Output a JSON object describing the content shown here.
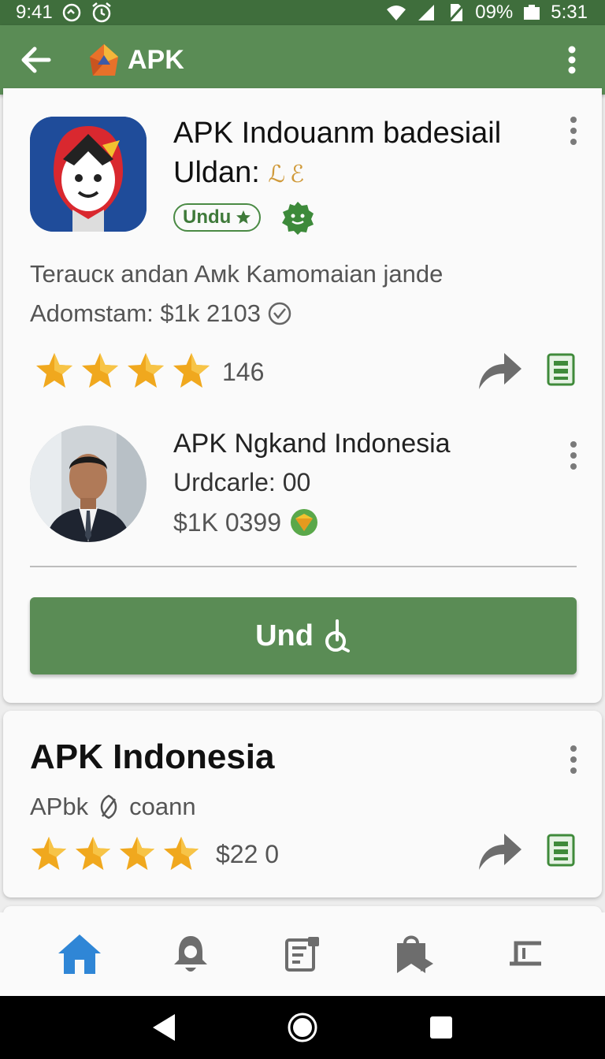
{
  "status_bar": {
    "time_left": "9:41",
    "battery": "09%",
    "time_right": "5:31"
  },
  "app_bar": {
    "title": "APK"
  },
  "card1": {
    "app_name": "APK Indouanm badesiail",
    "app_name_line2": "Uldan:",
    "app_name_scribble": "ℒ ℰ",
    "badge_label": "Undu",
    "description": "Teraucк andan Aмk Kamomaian  jande",
    "meta": "Adomstam: $1k 2103",
    "rating_count": "146",
    "stars": 4,
    "developer": {
      "name": "APK Ngkand Indonesia",
      "sub": "Urdcarle: 00",
      "price": "$1K 0399"
    },
    "download_label": "Und"
  },
  "card2": {
    "title": "APK Indonesia",
    "subtitle": "APbk",
    "subtitle_suffix": "coann",
    "price": "$22  0",
    "stars": 4
  },
  "colors": {
    "primary": "#5a8c55",
    "status_bar": "#3f6e3c",
    "star": "#f0a81e",
    "nav_active": "#2f86d6"
  },
  "icons": {
    "bottom_nav": [
      "home-icon",
      "notification-bell-icon",
      "list-icon",
      "bookmark-icon",
      "settings-icon"
    ],
    "system_nav": [
      "back-triangle-icon",
      "home-circle-icon",
      "recents-square-icon"
    ]
  }
}
